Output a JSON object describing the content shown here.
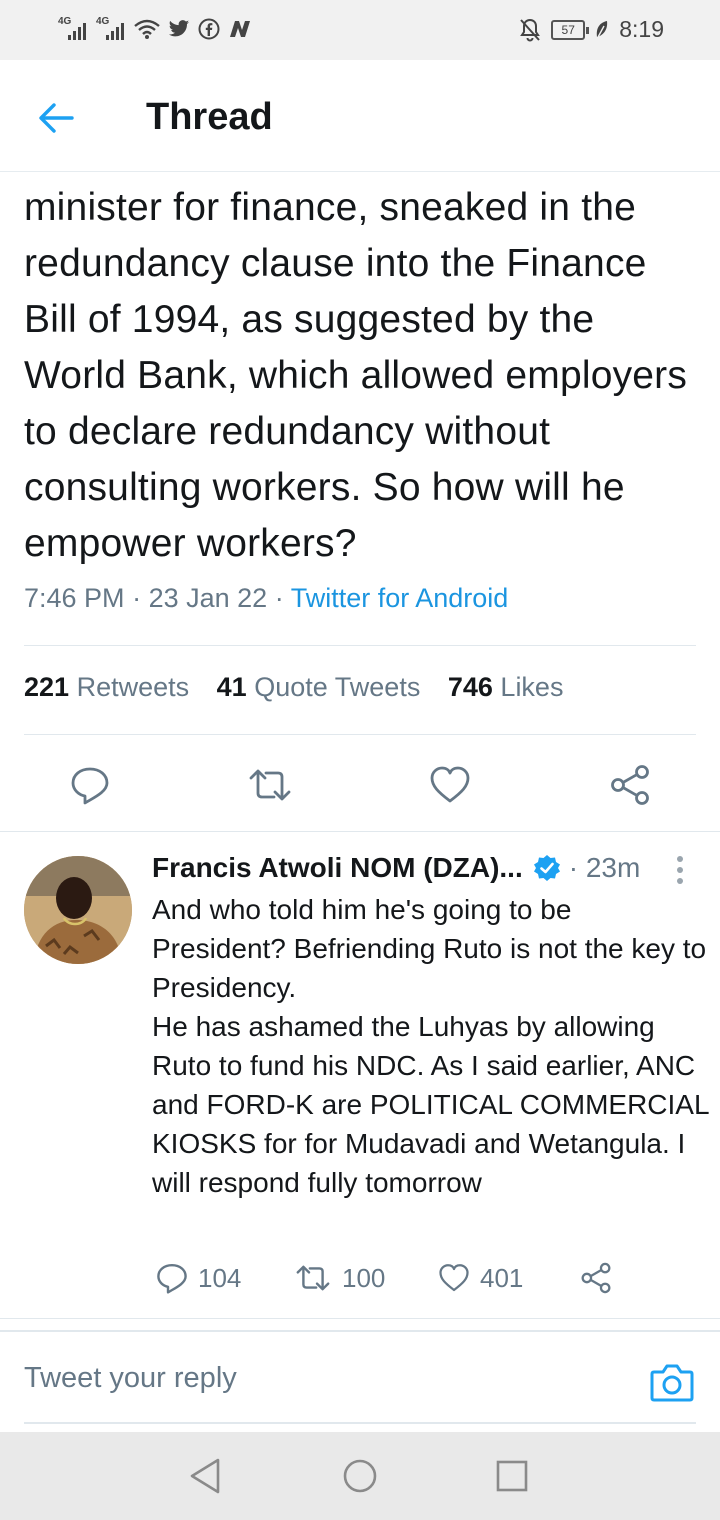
{
  "status_bar": {
    "signal1_label": "4G",
    "signal2_label": "4G",
    "battery_level": "57",
    "time": "8:19",
    "icons": [
      "wifi-icon",
      "twitter-icon",
      "facebook-icon",
      "n-app-icon",
      "mute-icon",
      "leaf-icon"
    ]
  },
  "header": {
    "title": "Thread",
    "back_icon": "arrow-left-icon"
  },
  "tweet": {
    "text": "minister for finance, sneaked in the redundancy clause into the Finance Bill of 1994, as suggested by the World Bank, which allowed employers to declare redundancy without consulting workers. So how will he empower workers?",
    "time": "7:46 PM",
    "date": "23 Jan 22",
    "source": "Twitter for Android",
    "retweets_count": "221",
    "retweets_label": "Retweets",
    "quotes_count": "41",
    "quotes_label": "Quote Tweets",
    "likes_count": "746",
    "likes_label": "Likes"
  },
  "reply": {
    "name": "Francis Atwoli NOM (DZA)...",
    "age": "23m",
    "text1": "And who told him he's going to be President? Befriending Ruto is not the key to Presidency.",
    "text2": "He has ashamed the Luhyas by allowing Ruto to fund his NDC. As I said earlier, ANC and FORD-K are POLITICAL COMMERCIAL KIOSKS for for Mudavadi and Wetangula. I will respond fully tomorrow",
    "replies": "104",
    "retweets": "100",
    "likes": "401"
  },
  "composer": {
    "placeholder": "Tweet your reply"
  },
  "colors": {
    "accent": "#1da1f2",
    "muted": "#657786",
    "text": "#14171a"
  }
}
